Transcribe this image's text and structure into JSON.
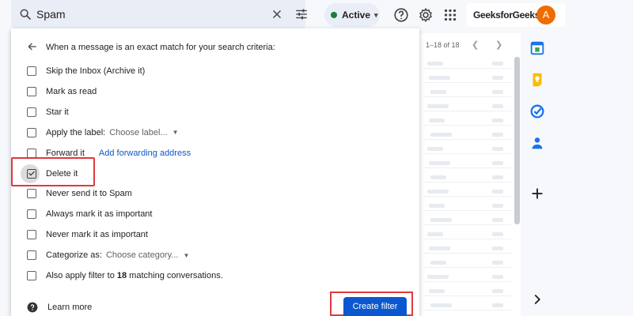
{
  "search": {
    "value": "Spam"
  },
  "status": {
    "label": "Active",
    "color": "#188038"
  },
  "account": {
    "brand": "GeeksforGeeks",
    "avatar_letter": "A",
    "avatar_color": "#ef6c00"
  },
  "mail": {
    "pager": "1–18 of 18"
  },
  "filter": {
    "header": "When a message is an exact match for your search criteria:",
    "options": [
      {
        "label": "Skip the Inbox (Archive it)",
        "checked": false
      },
      {
        "label": "Mark as read",
        "checked": false
      },
      {
        "label": "Star it",
        "checked": false
      },
      {
        "label": "Apply the label:",
        "select": "Choose label...",
        "checked": false
      },
      {
        "label": "Forward it",
        "link": "Add forwarding address",
        "checked": false
      },
      {
        "label": "Delete it",
        "checked": true
      },
      {
        "label": "Never send it to Spam",
        "checked": false
      },
      {
        "label": "Always mark it as important",
        "checked": false
      },
      {
        "label": "Never mark it as important",
        "checked": false
      },
      {
        "label": "Categorize as:",
        "select": "Choose category...",
        "checked": false
      },
      {
        "label_prefix": "Also apply filter to ",
        "count": "18",
        "label_suffix": " matching conversations.",
        "checked": false
      }
    ],
    "learn_more": "Learn more",
    "create_button": "Create filter"
  },
  "icons": [
    "search-icon",
    "close-icon",
    "tune-icon",
    "help-icon",
    "settings-icon",
    "apps-icon",
    "arrow-back-icon",
    "calendar-icon",
    "keep-icon",
    "tasks-icon",
    "contacts-icon",
    "plus-icon",
    "chevron-right-icon",
    "help-circle-icon"
  ]
}
